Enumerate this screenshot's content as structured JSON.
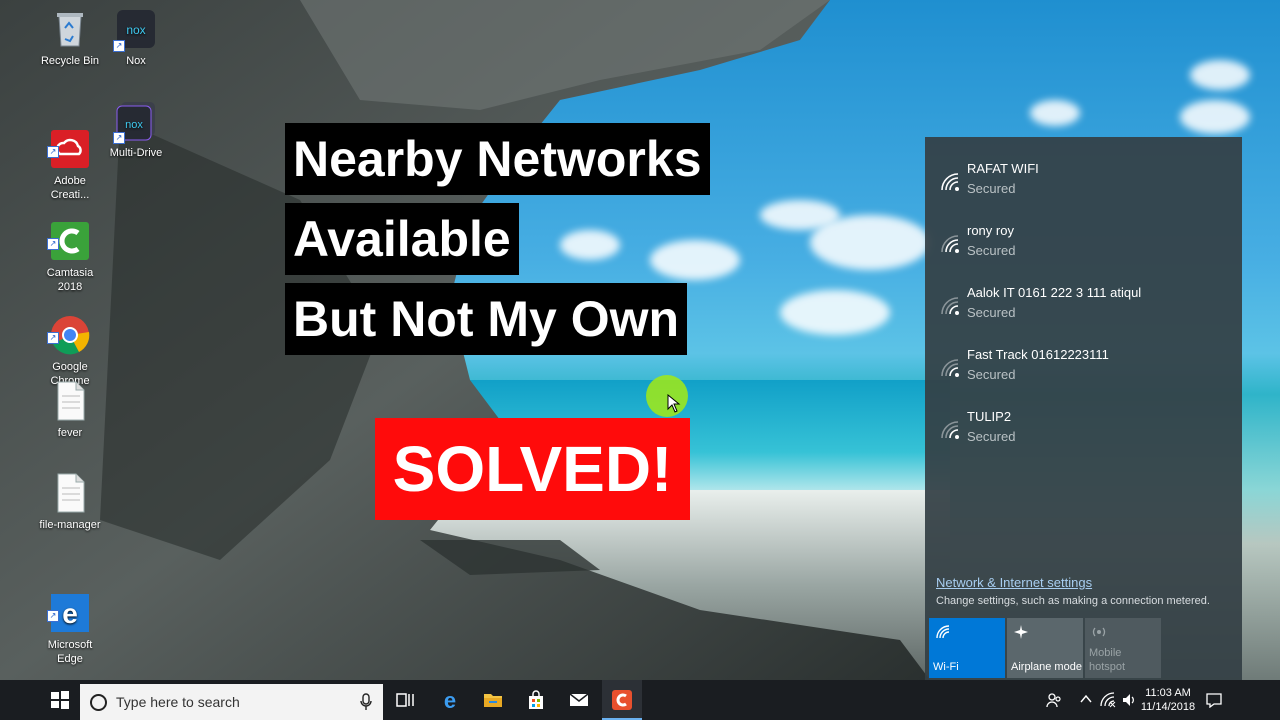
{
  "desktop": {
    "icons": [
      {
        "label": "Recycle Bin",
        "icon": "recycle-bin-icon"
      },
      {
        "label": "Nox",
        "icon": "nox-icon"
      },
      {
        "label": "Adobe\nCreati...",
        "icon": "adobe-creative-cloud-icon"
      },
      {
        "label": "Multi-Drive",
        "icon": "nox-multi-drive-icon"
      },
      {
        "label": "Camtasia\n2018",
        "icon": "camtasia-icon"
      },
      {
        "label": "Google\nChrome",
        "icon": "chrome-icon"
      },
      {
        "label": "fever",
        "icon": "document-icon"
      },
      {
        "label": "file-manager",
        "icon": "document-icon"
      },
      {
        "label": "Microsoft\nEdge",
        "icon": "edge-icon"
      }
    ]
  },
  "overlay": {
    "line1": "Nearby Networks",
    "line2": "Available",
    "line3": "But Not My Own",
    "badge": "SOLVED!",
    "badge_color": "#ff0b0b"
  },
  "network_flyout": {
    "networks": [
      {
        "name": "RAFAT WIFI",
        "status": "Secured"
      },
      {
        "name": "rony roy",
        "status": "Secured"
      },
      {
        "name": "Aalok IT 0161 222 3 111 atiqul",
        "status": "Secured"
      },
      {
        "name": "Fast Track 01612223111",
        "status": "Secured"
      },
      {
        "name": "TULIP2",
        "status": "Secured"
      }
    ],
    "settings_link": "Network & Internet settings",
    "settings_desc": "Change settings, such as making a connection metered.",
    "quick_actions": [
      {
        "label": "Wi-Fi",
        "active": true,
        "icon": "wifi-icon"
      },
      {
        "label": "Airplane mode",
        "active": false,
        "icon": "airplane-icon"
      },
      {
        "label": "Mobile\nhotspot",
        "active": false,
        "disabled": true,
        "icon": "hotspot-icon"
      }
    ],
    "accent_color": "#0078d7"
  },
  "taskbar": {
    "search_placeholder": "Type here to search",
    "apps": [
      "task-view-icon",
      "edge-icon",
      "file-explorer-icon",
      "store-icon",
      "mail-icon",
      "camtasia-icon"
    ],
    "time": "11:03 AM",
    "date": "11/14/2018"
  }
}
